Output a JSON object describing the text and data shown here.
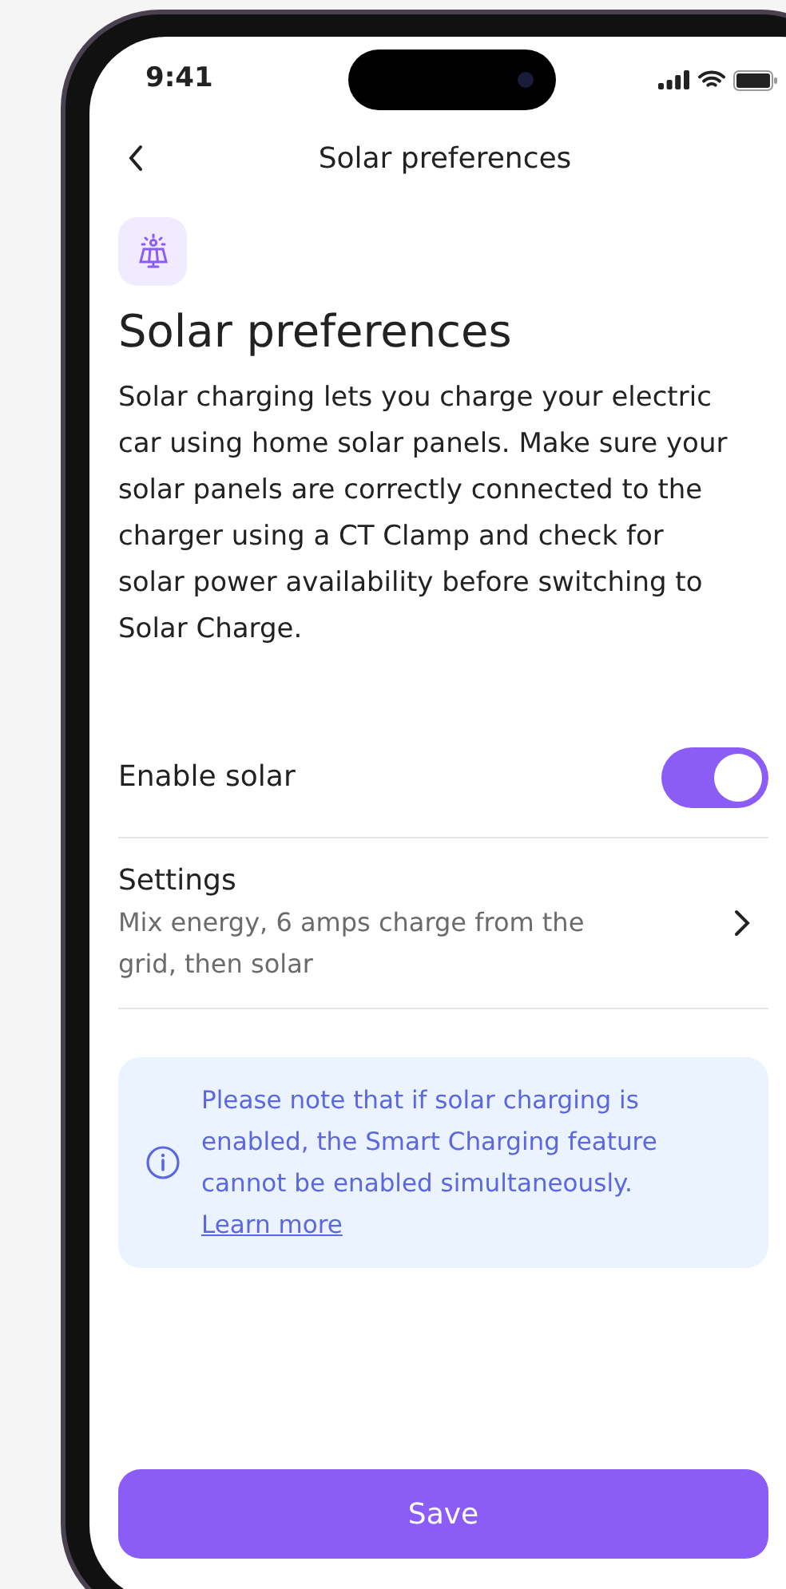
{
  "status_bar": {
    "time": "9:41"
  },
  "nav": {
    "title": "Solar preferences"
  },
  "header": {
    "title": "Solar preferences",
    "description": "Solar charging lets you charge your electric car using home solar panels. Make sure your solar panels are correctly connected to the charger using a CT Clamp and check for solar power availability before switching to Solar Charge."
  },
  "settings": [
    {
      "kind": "toggle",
      "label": "Enable solar",
      "on": true
    },
    {
      "kind": "link",
      "label": "Settings",
      "detail": "Mix energy, 6 amps charge from the grid, then solar"
    }
  ],
  "notice": {
    "text": "Please note that if solar charging is enabled, the Smart Charging feature cannot be enabled simultaneously.",
    "link": "Learn more"
  },
  "save_button": {
    "label": "Save"
  }
}
